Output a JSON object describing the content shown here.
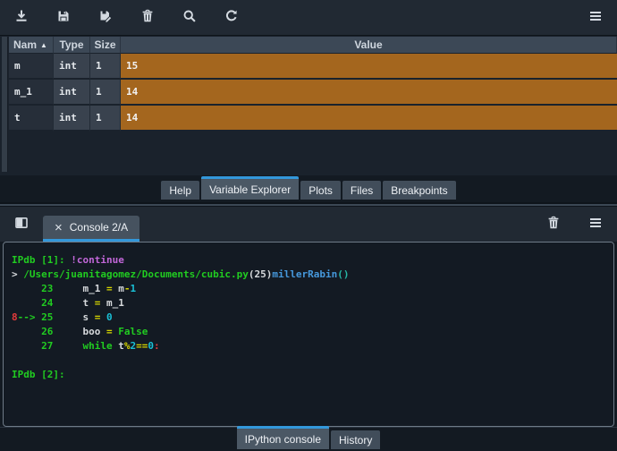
{
  "variable_explorer": {
    "toolbar": {
      "icons": [
        "import-icon",
        "save-icon",
        "save-as-icon",
        "delete-icon",
        "search-icon",
        "refresh-icon",
        "menu-icon"
      ]
    },
    "table": {
      "header": {
        "name": "Nam",
        "sort": "▲",
        "type": "Type",
        "size": "Size",
        "value": "Value"
      },
      "rows": [
        {
          "name": "m",
          "type": "int",
          "size": "1",
          "value": "15"
        },
        {
          "name": "m_1",
          "type": "int",
          "size": "1",
          "value": "14"
        },
        {
          "name": "t",
          "type": "int",
          "size": "1",
          "value": "14"
        }
      ]
    },
    "tabs": [
      {
        "label": "Help",
        "active": false
      },
      {
        "label": "Variable Explorer",
        "active": true
      },
      {
        "label": "Plots",
        "active": false
      },
      {
        "label": "Files",
        "active": false
      },
      {
        "label": "Breakpoints",
        "active": false
      }
    ]
  },
  "console_pane": {
    "header": {
      "icons": [
        "new-window-icon",
        "interrupt-icon",
        "delete-icon",
        "menu-icon"
      ],
      "tab_label": "Console 2/A",
      "close_glyph": "×"
    },
    "lines": [
      [
        {
          "t": "IPdb [1]: ",
          "c": "green"
        },
        {
          "t": "!continue",
          "c": "purple"
        }
      ],
      [
        {
          "t": "> ",
          "c": "fg"
        },
        {
          "t": "/Users/juanitagomez/Documents/cubic.py",
          "c": "green"
        },
        {
          "t": "(25)",
          "c": "fg"
        },
        {
          "t": "millerRabin",
          "c": "blue"
        },
        {
          "t": "()",
          "c": "teal"
        }
      ],
      [
        {
          "t": "     23     ",
          "c": "green"
        },
        {
          "t": "m_1 ",
          "c": "fg"
        },
        {
          "t": "= ",
          "c": "yellow"
        },
        {
          "t": "m",
          "c": "fg"
        },
        {
          "t": "-",
          "c": "yellow"
        },
        {
          "t": "1",
          "c": "cyan"
        }
      ],
      [
        {
          "t": "     24     ",
          "c": "green"
        },
        {
          "t": "t ",
          "c": "fg"
        },
        {
          "t": "= ",
          "c": "yellow"
        },
        {
          "t": "m_1",
          "c": "fg"
        }
      ],
      [
        {
          "t": "8",
          "c": "red"
        },
        {
          "t": "--> 25     ",
          "c": "green"
        },
        {
          "t": "s ",
          "c": "fg"
        },
        {
          "t": "= ",
          "c": "yellow"
        },
        {
          "t": "0",
          "c": "cyan"
        }
      ],
      [
        {
          "t": "     26     ",
          "c": "green"
        },
        {
          "t": "boo ",
          "c": "fg"
        },
        {
          "t": "= ",
          "c": "yellow"
        },
        {
          "t": "False",
          "c": "green"
        }
      ],
      [
        {
          "t": "     27     ",
          "c": "green"
        },
        {
          "t": "while ",
          "c": "green"
        },
        {
          "t": "t",
          "c": "fg"
        },
        {
          "t": "%",
          "c": "yellow"
        },
        {
          "t": "2",
          "c": "cyan"
        },
        {
          "t": "==",
          "c": "yellow"
        },
        {
          "t": "0",
          "c": "cyan"
        },
        {
          "t": ":",
          "c": "red"
        }
      ],
      [],
      [
        {
          "t": "IPdb [2]: ",
          "c": "green"
        }
      ]
    ],
    "tabs": [
      {
        "label": "IPython console",
        "active": true
      },
      {
        "label": "History",
        "active": false
      }
    ]
  },
  "colors": {
    "accent_blue": "#3398db",
    "value_cell_orange": "#a4661e",
    "prompt_green": "#21cc21",
    "magic_purple": "#c267d9",
    "function_blue": "#4699dd",
    "paren_teal": "#27b8a6",
    "operator_yellow": "#d6d600",
    "number_cyan": "#1ac0d6",
    "marker_red": "#e23b3b",
    "interrupt_red": "#cc1111"
  }
}
